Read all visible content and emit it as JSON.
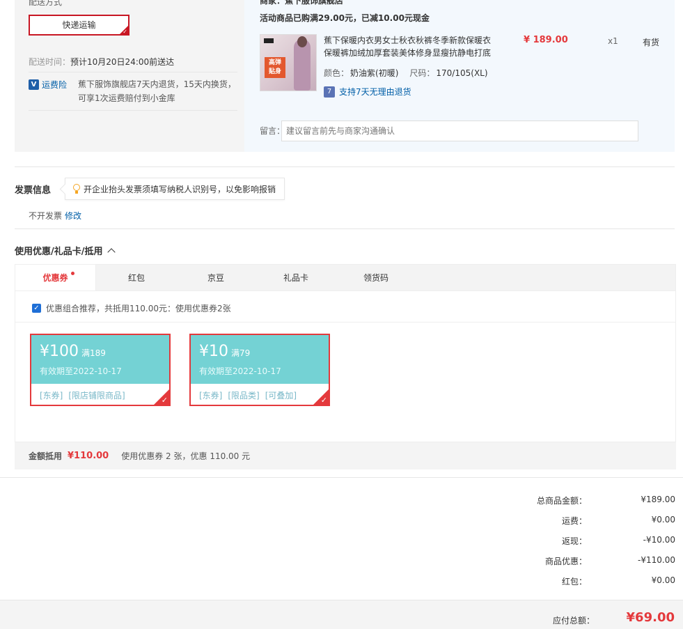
{
  "shipping": {
    "title": "配送方式",
    "method_button": "快递运输",
    "delivery_time_label": "配送时间：",
    "delivery_time_value": "预计10月20日24:00前送达",
    "freight_insurance_label": "运费险",
    "freight_insurance_desc": "蕉下服饰旗舰店7天内退货，15天内换货，可享1次运费赔付到小金库"
  },
  "shop": {
    "seller": "商家：蕉下服饰旗舰店",
    "promotion": "活动商品已购满29.00元，已减10.00元现金"
  },
  "product": {
    "thumb_badge": "高弹 贴身",
    "name": "蕉下保暖内衣男女士秋衣秋裤冬季新款保暖衣保暖裤加绒加厚套装美体修身显瘦抗静电打底",
    "price": "¥ 189.00",
    "quantity": "x1",
    "stock": "有货",
    "color_label": "颜色：",
    "color_value": "奶油紫(初暖)",
    "size_label": "尺码：",
    "size_value": "170/105(XL)",
    "return_policy": "支持7天无理由退货"
  },
  "message": {
    "label": "留言：",
    "placeholder": "建议留言前先与商家沟通确认"
  },
  "invoice": {
    "title": "发票信息",
    "tip": "开企业抬头发票须填写纳税人识别号，以免影响报销",
    "state": "不开发票",
    "edit_link": "修改"
  },
  "coupons": {
    "title": "使用优惠/礼品卡/抵用",
    "tabs": [
      {
        "label": "优惠券"
      },
      {
        "label": "红包"
      },
      {
        "label": "京豆"
      },
      {
        "label": "礼品卡"
      },
      {
        "label": "领货码"
      }
    ],
    "recommend_text": "优惠组合推荐，共抵用110.00元：使用优惠券2张",
    "items": [
      {
        "amount": "¥100",
        "condition": "满189",
        "expiry": "有效期至2022-10-17",
        "tags": [
          "[东券]",
          "[限店铺限商品]"
        ]
      },
      {
        "amount": "¥10",
        "condition": "满79",
        "expiry": "有效期至2022-10-17",
        "tags": [
          "[东券]",
          "[限品类]",
          "[可叠加]"
        ]
      }
    ],
    "deduct_label": "金额抵用",
    "deduct_amount": "¥110.00",
    "deduct_text": "使用优惠券 2 张，优惠 110.00 元"
  },
  "summary": {
    "rows": [
      {
        "label": "总商品金额：",
        "value": "¥189.00"
      },
      {
        "label": "运费：",
        "value": "¥0.00"
      },
      {
        "label": "返现：",
        "value": "-¥10.00"
      },
      {
        "label": "商品优惠：",
        "value": "-¥110.00"
      },
      {
        "label": "红包：",
        "value": "¥0.00"
      }
    ],
    "total_label": "应付总额：",
    "total_value": "¥69.00"
  },
  "colors": {
    "accent_red": "#e4393c",
    "link_blue": "#005ea7",
    "coupon_teal": "#74d2d4"
  }
}
